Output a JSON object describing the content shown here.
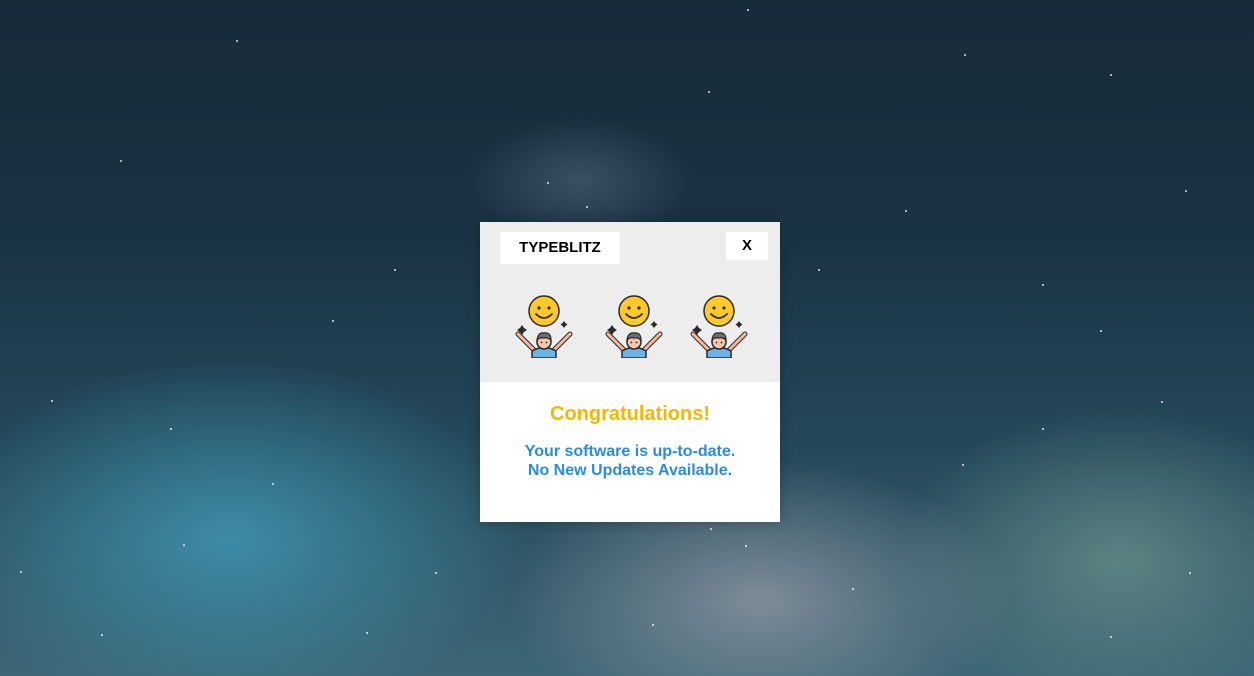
{
  "dialog": {
    "title": "TYPEBLITZ",
    "close_label": "X",
    "icons": [
      "celebrating-person-icon",
      "celebrating-person-icon",
      "celebrating-person-icon"
    ],
    "headline": "Congratulations!",
    "message_line1": "Your software is up-to-date.",
    "message_line2": "No New Updates Available."
  },
  "colors": {
    "headline": "#f5b800",
    "message": "#2b8cde",
    "header_bg": "#ededed"
  }
}
